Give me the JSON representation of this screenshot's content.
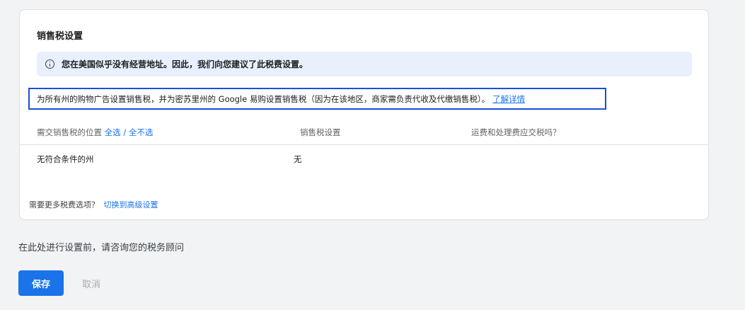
{
  "card": {
    "title": "销售税设置",
    "info_banner": {
      "icon": "info-icon",
      "text": "您在美国似乎没有经营地址。因此，我们向您建议了此税费设置。"
    },
    "description": {
      "text": "为所有州的购物广告设置销售税，并为密苏里州的 Google 易购设置销售税（因为在该地区，商家需负责代收及代缴销售税）。",
      "link_label": "了解详情"
    },
    "table": {
      "headers": {
        "location_label": "需交销售税的位置",
        "select_all": "全选",
        "separator": "/",
        "select_none": "全不选",
        "tax_setting": "销售税设置",
        "shipping_taxable": "运费和处理费应交税吗？"
      },
      "rows": [
        {
          "location": "无符合条件的州",
          "tax_setting": "无",
          "shipping_taxable": ""
        }
      ]
    },
    "more_options": {
      "text": "需要更多税费选项？",
      "link_label": "切换到高级设置"
    }
  },
  "consult_text": "在此处进行设置前，请咨询您的税务顾问",
  "actions": {
    "save_label": "保存",
    "cancel_label": "取消"
  },
  "colors": {
    "primary": "#1a73e8",
    "banner_bg": "#e8f0fe",
    "highlight_border": "#1a4fd6",
    "disabled_text": "#a7abb0"
  }
}
